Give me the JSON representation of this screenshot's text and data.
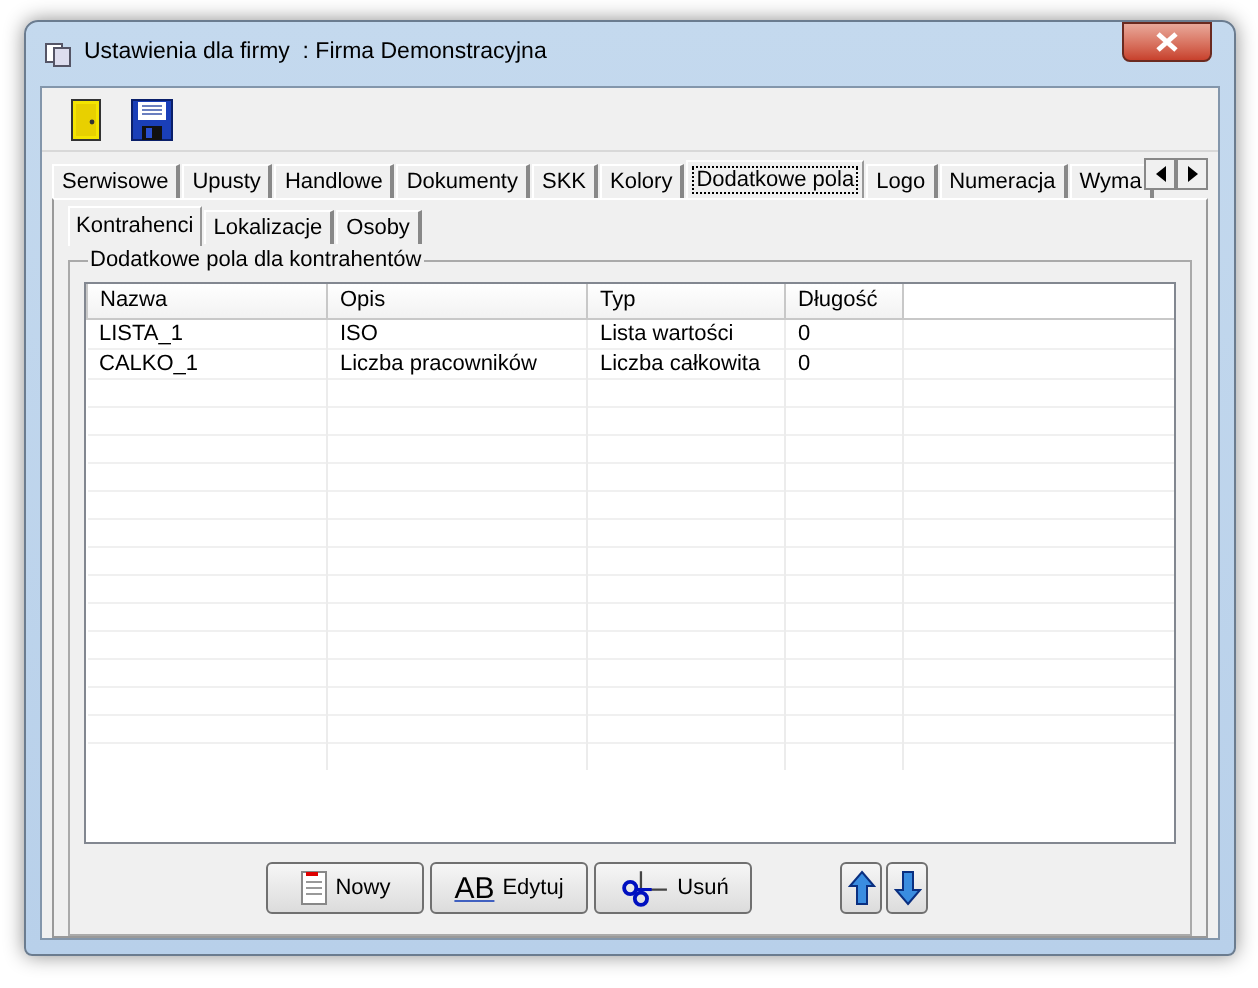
{
  "window": {
    "title": "Ustawienia dla firmy  : Firma Demonstracyjna"
  },
  "toolbar": [
    {
      "kind": "door"
    },
    {
      "kind": "save"
    }
  ],
  "tabs": [
    {
      "label": "Serwisowe",
      "selected": false
    },
    {
      "label": "Upusty",
      "selected": false
    },
    {
      "label": "Handlowe",
      "selected": false
    },
    {
      "label": "Dokumenty",
      "selected": false
    },
    {
      "label": "SKK",
      "selected": false
    },
    {
      "label": "Kolory",
      "selected": false
    },
    {
      "label": "Dodatkowe pola",
      "selected": true
    },
    {
      "label": "Logo",
      "selected": false
    },
    {
      "label": "Numeracja",
      "selected": false
    },
    {
      "label": "Wyma",
      "selected": false
    }
  ],
  "subtabs": [
    {
      "label": "Kontrahenci",
      "selected": true
    },
    {
      "label": "Lokalizacje",
      "selected": false
    },
    {
      "label": "Osoby",
      "selected": false
    }
  ],
  "group": {
    "title": "Dodatkowe pola dla kontrahentów"
  },
  "table": {
    "columns": [
      "Nazwa",
      "Opis",
      "Typ",
      "Długość"
    ],
    "rows": [
      [
        "LISTA_1",
        "ISO",
        "Lista wartości",
        "0"
      ],
      [
        "CALKO_1",
        "Liczba pracowników",
        "Liczba całkowita",
        "0"
      ]
    ]
  },
  "buttons": [
    {
      "kind": "new",
      "label": "Nowy"
    },
    {
      "kind": "edit",
      "label": "Edytuj",
      "icon_letters": "AB"
    },
    {
      "kind": "delete",
      "label": "Usuń"
    },
    {
      "kind": "up"
    },
    {
      "kind": "down"
    }
  ]
}
